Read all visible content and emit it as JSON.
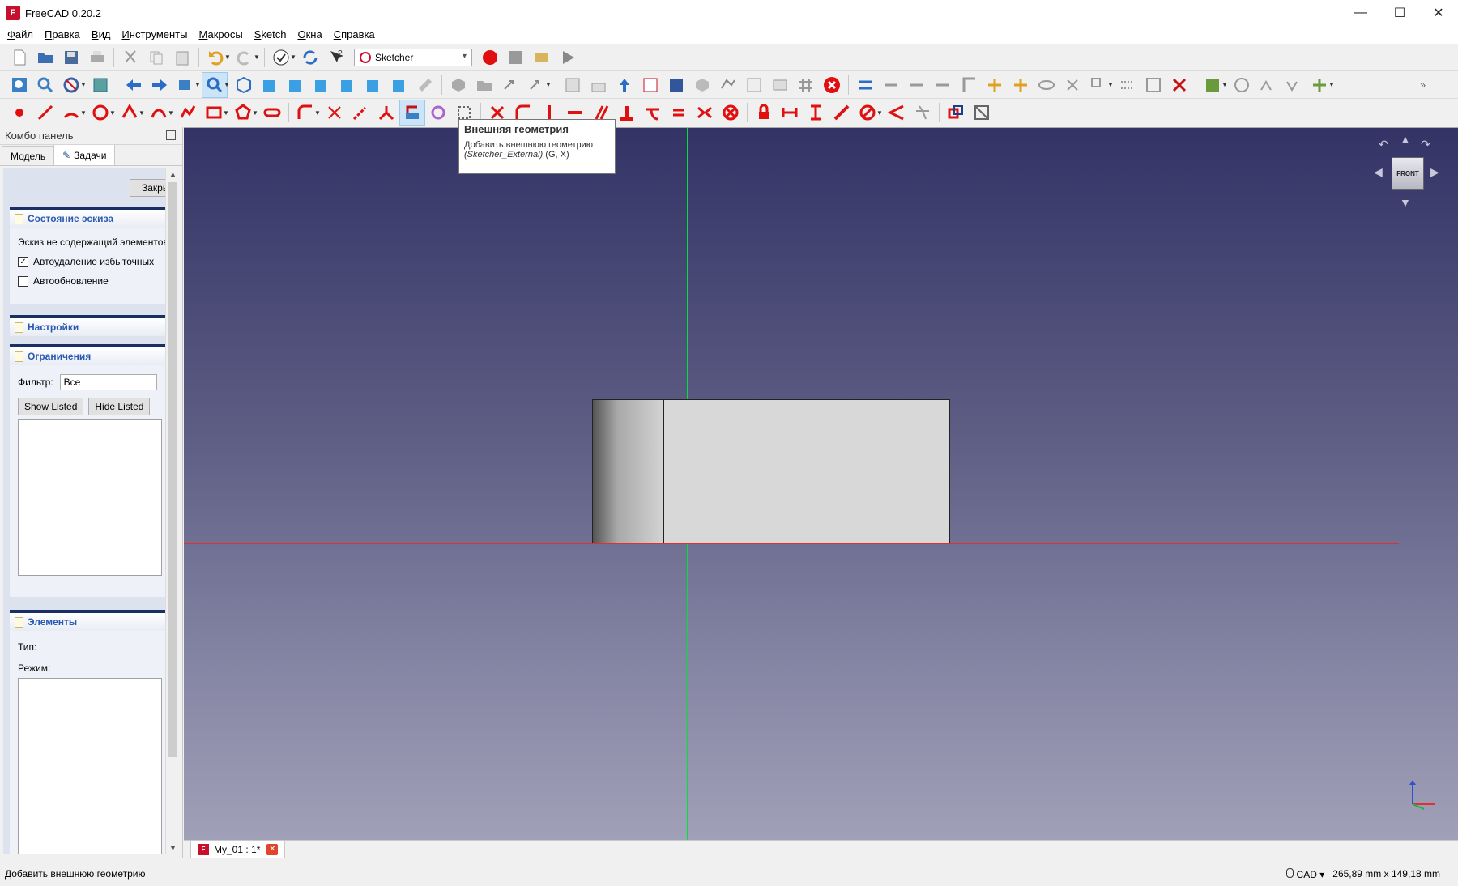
{
  "window": {
    "title": "FreeCAD 0.20.2",
    "app_icon": "freecad-logo-icon",
    "minimize": "—",
    "maximize": "☐",
    "close": "✕"
  },
  "menu": [
    "Файл",
    "Правка",
    "Вид",
    "Инструменты",
    "Макросы",
    "Sketch",
    "Окна",
    "Справка"
  ],
  "toolbar": {
    "workbench_value": "Sketcher",
    "overflow": "»"
  },
  "combo": {
    "title": "Комбо панель",
    "tabs": [
      {
        "label": "Модель",
        "active": false
      },
      {
        "label": "Задачи",
        "active": true
      }
    ],
    "close_button": "Закрыть"
  },
  "sketch_state": {
    "title": "Состояние эскиза",
    "status_text": "Эскиз не содержащий элементов",
    "auto_remove_label": "Автоудаление избыточных",
    "auto_remove_checked": true,
    "auto_update_label": "Автообновление",
    "auto_update_checked": false
  },
  "settings": {
    "title": "Настройки"
  },
  "constraints": {
    "title": "Ограничения",
    "filter_label": "Фильтр:",
    "filter_value": "Все",
    "show_listed": "Show Listed",
    "hide_listed": "Hide Listed"
  },
  "elements": {
    "title": "Элементы",
    "type_label": "Тип:",
    "mode_label": "Режим:"
  },
  "navcube": {
    "face": "FRONT"
  },
  "document_tab": {
    "label": "My_01 : 1*"
  },
  "tooltip": {
    "title": "Внешняя геометрия",
    "description": "Добавить внешнюю геометрию",
    "command": "(Sketcher_External)",
    "shortcut": "(G, X)"
  },
  "status": {
    "message": "Добавить внешнюю геометрию",
    "nav_style": "CAD",
    "dimensions": "265,89 mm x 149,18 mm"
  },
  "colors": {
    "x_axis": "#e03030",
    "y_axis": "#00e040",
    "accent_red": "#c8102e",
    "task_header_text": "#2a5ab0"
  }
}
